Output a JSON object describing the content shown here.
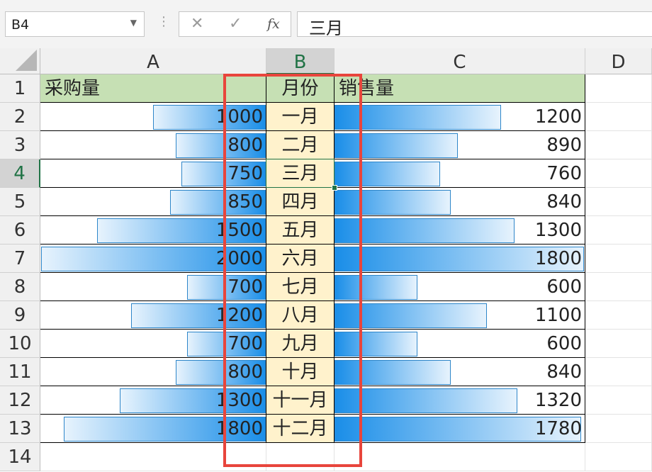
{
  "name_box": "B4",
  "formula_buttons": {
    "cancel": "✕",
    "enter": "✓",
    "fx": "fx"
  },
  "formula_value": "三月",
  "columns": [
    "A",
    "B",
    "C",
    "D"
  ],
  "rows": [
    "1",
    "2",
    "3",
    "4",
    "5",
    "6",
    "7",
    "8",
    "9",
    "10",
    "11",
    "12",
    "13",
    "14"
  ],
  "headers": {
    "purchase": "采购量",
    "month": "月份",
    "sales": "销售量"
  },
  "data": [
    {
      "purchase": 1000,
      "month": "一月",
      "sales": 1200
    },
    {
      "purchase": 800,
      "month": "二月",
      "sales": 890
    },
    {
      "purchase": 750,
      "month": "三月",
      "sales": 760
    },
    {
      "purchase": 850,
      "month": "四月",
      "sales": 840
    },
    {
      "purchase": 1500,
      "month": "五月",
      "sales": 1300
    },
    {
      "purchase": 2000,
      "month": "六月",
      "sales": 1800
    },
    {
      "purchase": 700,
      "month": "七月",
      "sales": 600
    },
    {
      "purchase": 1200,
      "month": "八月",
      "sales": 1100
    },
    {
      "purchase": 700,
      "month": "九月",
      "sales": 600
    },
    {
      "purchase": 800,
      "month": "十月",
      "sales": 840
    },
    {
      "purchase": 1300,
      "month": "十一月",
      "sales": 1320
    },
    {
      "purchase": 1800,
      "month": "十二月",
      "sales": 1780
    }
  ],
  "selected_cell": {
    "col": "B",
    "row": "4"
  },
  "colors": {
    "header_fill": "#c6e0b4",
    "month_fill": "#fff2cc",
    "databar": "#1a8ee8",
    "highlight": "#e8453c",
    "selection": "#217346"
  }
}
